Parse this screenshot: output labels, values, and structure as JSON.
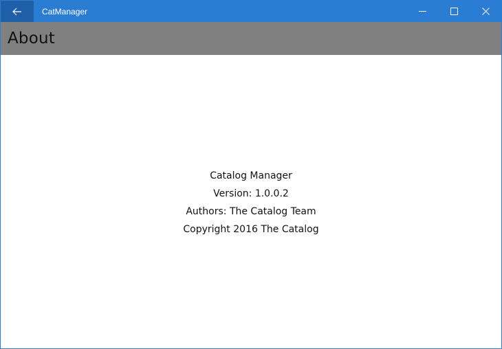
{
  "window": {
    "app_title": "CatManager",
    "accent_color": "#2b7cd3",
    "back_button_color": "#1e5fa8",
    "header_color": "#808080",
    "controls": {
      "back_icon": "arrow-left-icon",
      "minimize_icon": "minimize-icon",
      "maximize_icon": "maximize-icon",
      "close_icon": "close-icon"
    }
  },
  "page": {
    "title": "About"
  },
  "about": {
    "product_name": "Catalog Manager",
    "version": "Version: 1.0.0.2",
    "authors": "Authors: The Catalog Team",
    "copyright": "Copyright 2016 The Catalog"
  }
}
